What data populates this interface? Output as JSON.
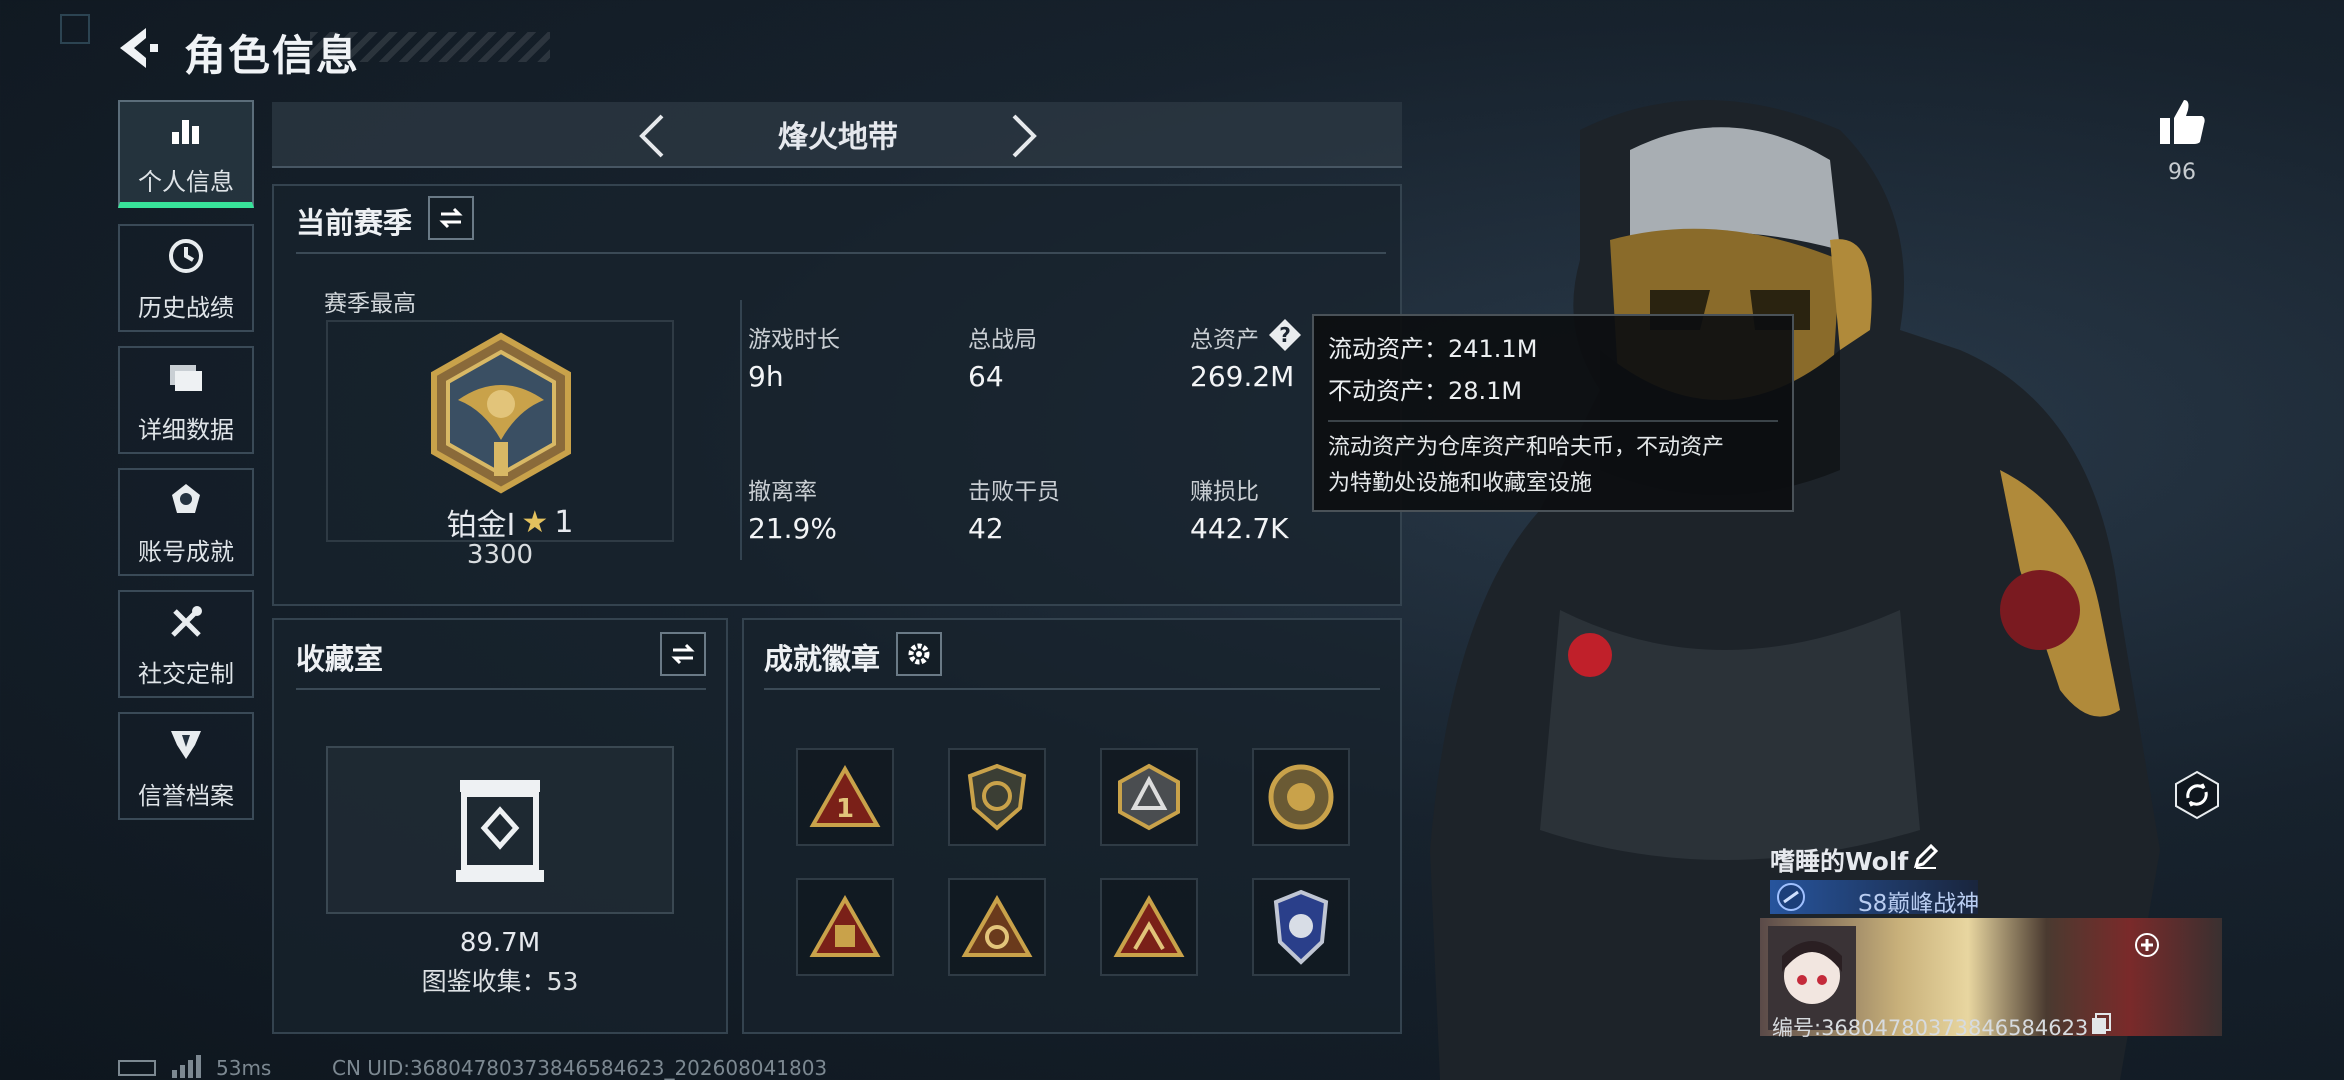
{
  "header": {
    "title": "角色信息"
  },
  "sidebar": {
    "items": [
      {
        "label": "个人信息",
        "icon": "bar-chart-icon",
        "active": true
      },
      {
        "label": "历史战绩",
        "icon": "history-icon"
      },
      {
        "label": "详细数据",
        "icon": "folder-icon"
      },
      {
        "label": "账号成就",
        "icon": "achievement-icon"
      },
      {
        "label": "社交定制",
        "icon": "tools-icon"
      },
      {
        "label": "信誉档案",
        "icon": "reputation-icon"
      }
    ]
  },
  "mode_selector": {
    "label": "烽火地带"
  },
  "season": {
    "title": "当前赛季",
    "best_label": "赛季最高",
    "rank_name": "铂金Ⅰ",
    "rank_stars": "1",
    "rank_score": "3300",
    "stats": [
      {
        "label": "游戏时长",
        "value": "9h"
      },
      {
        "label": "总战局",
        "value": "64"
      },
      {
        "label": "总资产",
        "value": "269.2M"
      },
      {
        "label": "撤离率",
        "value": "21.9%"
      },
      {
        "label": "击败干员",
        "value": "42"
      },
      {
        "label": "赚损比",
        "value": "442.7K"
      }
    ]
  },
  "tooltip": {
    "liquid": "流动资产：241.1M",
    "fixed": "不动资产：28.1M",
    "desc_line1": "流动资产为仓库资产和哈夫币，不动资产",
    "desc_line2": "为特勤处设施和收藏室设施"
  },
  "collection": {
    "title": "收藏室",
    "value": "89.7M",
    "catalog": "图鉴收集：53"
  },
  "badges": {
    "title": "成就徽章",
    "items": [
      "badge-1",
      "badge-2",
      "badge-3",
      "badge-4",
      "badge-5",
      "badge-6",
      "badge-7",
      "badge-8"
    ]
  },
  "likes": {
    "count": "96"
  },
  "profile": {
    "name": "嗜睡的Wolf",
    "title_badge": "S8巅峰战神",
    "id_text": "编号:3680478037384658462​3"
  },
  "status": {
    "ping": "53ms",
    "uid": "CN UID:3680478037384658462​3_202608041803"
  },
  "colors": {
    "accent_green": "#38e39a",
    "gold": "#c9a24a",
    "bg": "#17222d"
  }
}
